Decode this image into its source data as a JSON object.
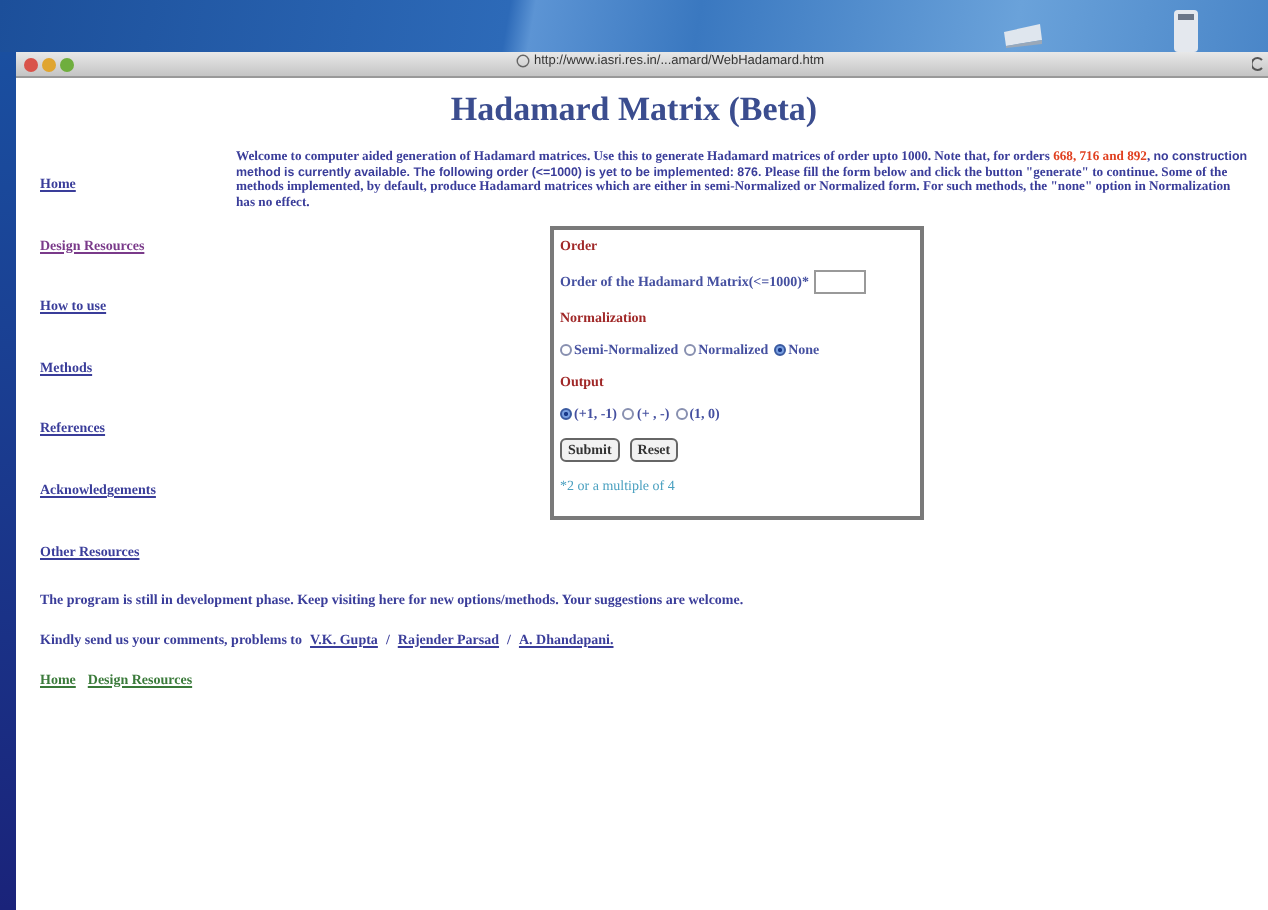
{
  "window": {
    "url": "http://www.iasri.res.in/...amard/WebHadamard.htm"
  },
  "page": {
    "title": "Hadamard Matrix (Beta)",
    "intro": [
      {
        "kind": "plain",
        "text": "Welcome to computer aided generation of Hadamard matrices. Use this to generate Hadamard matrices of order upto 1000. Note that, for orders "
      },
      {
        "kind": "highlight",
        "text": "668, 716 and 892"
      },
      {
        "kind": "plain",
        "text": ", "
      },
      {
        "kind": "sans",
        "text": "no construction method is currently available. The following order (<=1000) is yet to be implemented: 876."
      },
      {
        "kind": "plain",
        "text": " Please fill the form below and click the button \"generate\" to continue. Some of the methods implemented, by default, produce Hadamard matrices which are either in semi-Normalized or Normalized form. For such methods, the \"none\" option in Normalization has no effect."
      }
    ]
  },
  "sidebar": {
    "items": [
      {
        "label": "Home",
        "visited": false
      },
      {
        "label": "Design Resources",
        "visited": true
      },
      {
        "label": "How to use",
        "visited": false
      },
      {
        "label": "Methods",
        "visited": false
      },
      {
        "label": "References",
        "visited": false
      },
      {
        "label": "Acknowledgements",
        "visited": false
      },
      {
        "label": "Other Resources",
        "visited": false
      }
    ]
  },
  "form": {
    "order_heading": "Order",
    "order_label": "Order of the Hadamard Matrix(<=1000)*",
    "normalization_heading": "Normalization",
    "normalization": [
      {
        "label": "Semi-Normalized",
        "selected": false
      },
      {
        "label": "Normalized",
        "selected": false
      },
      {
        "label": "None",
        "selected": true
      }
    ],
    "output_heading": "Output",
    "output": [
      {
        "label": "(+1, -1)",
        "selected": true
      },
      {
        "label": "(+ , -)",
        "selected": false
      },
      {
        "label": "(1, 0)",
        "selected": false
      }
    ],
    "buttons": [
      "Submit",
      "Reset"
    ],
    "note": "*2 or a multiple of 4"
  },
  "footer": {
    "status": "The program is still in development phase. Keep visiting here for new options/methods. Your suggestions are welcome.",
    "contact_prefix": "Kindly send us your comments, problems to",
    "contacts": [
      {
        "name": "V.K. Gupta",
        "separator": "/"
      },
      {
        "name": "Rajender Parsad",
        "separator": "/"
      },
      {
        "name": "A. Dhandapani."
      }
    ],
    "links": [
      "Home",
      "Design Resources"
    ]
  }
}
